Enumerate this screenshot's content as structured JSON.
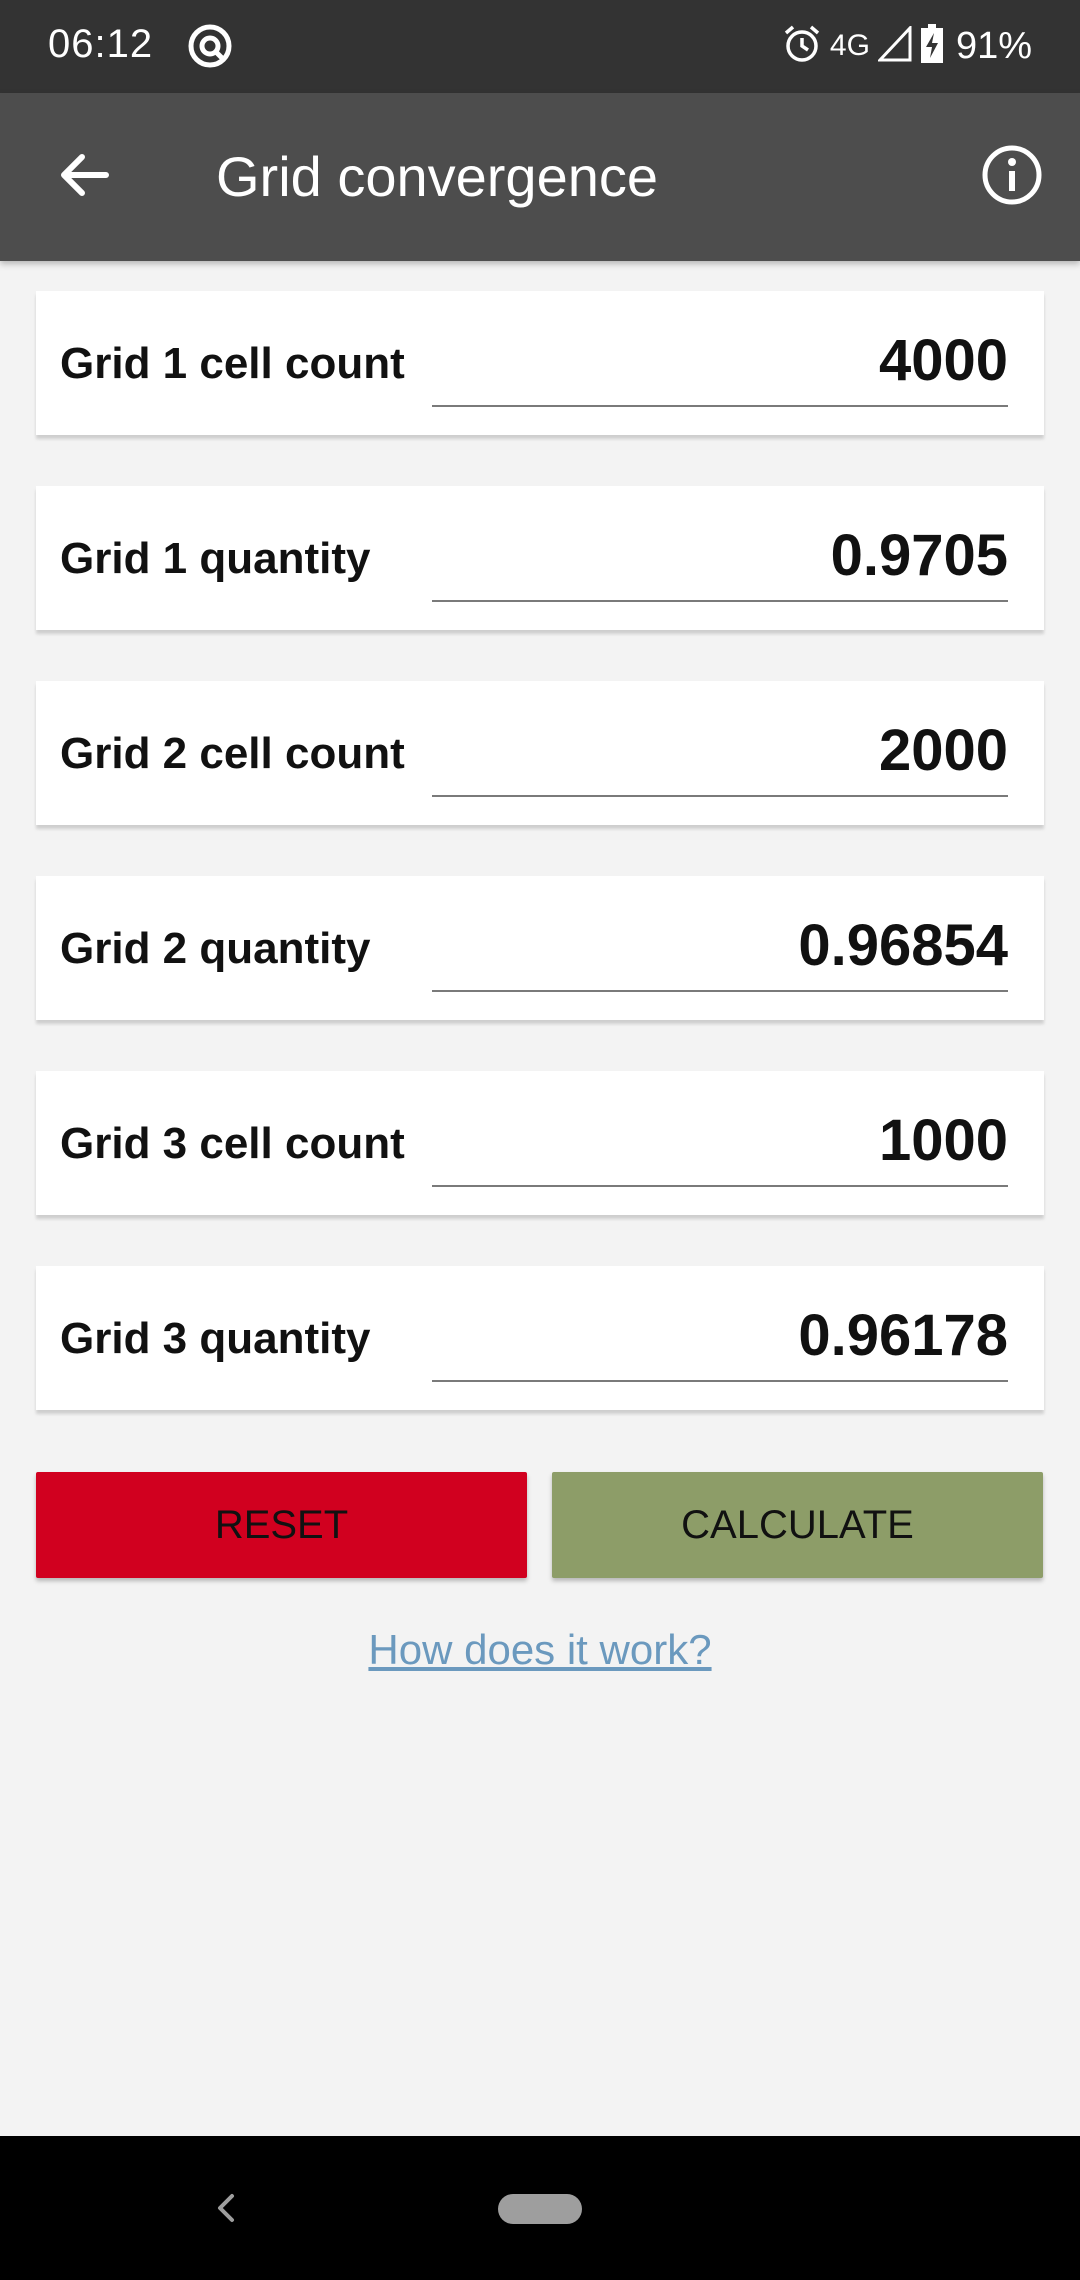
{
  "status_bar": {
    "time": "06:12",
    "network": "4G",
    "battery": "91%"
  },
  "app_bar": {
    "title": "Grid convergence"
  },
  "fields": [
    {
      "label": "Grid 1 cell count",
      "value": "4000"
    },
    {
      "label": "Grid 1 quantity",
      "value": "0.9705"
    },
    {
      "label": "Grid 2 cell count",
      "value": "2000"
    },
    {
      "label": "Grid 2 quantity",
      "value": "0.96854"
    },
    {
      "label": "Grid 3 cell count",
      "value": "1000"
    },
    {
      "label": "Grid 3 quantity",
      "value": "0.96178"
    }
  ],
  "buttons": {
    "reset": "RESET",
    "calculate": "CALCULATE"
  },
  "help_link": "How does it work?",
  "colors": {
    "status_bar": "#333333",
    "app_bar": "#4d4d4d",
    "reset": "#d1001f",
    "calculate": "#8d9d68",
    "link": "#6b99be",
    "background": "#f3f3f3"
  }
}
